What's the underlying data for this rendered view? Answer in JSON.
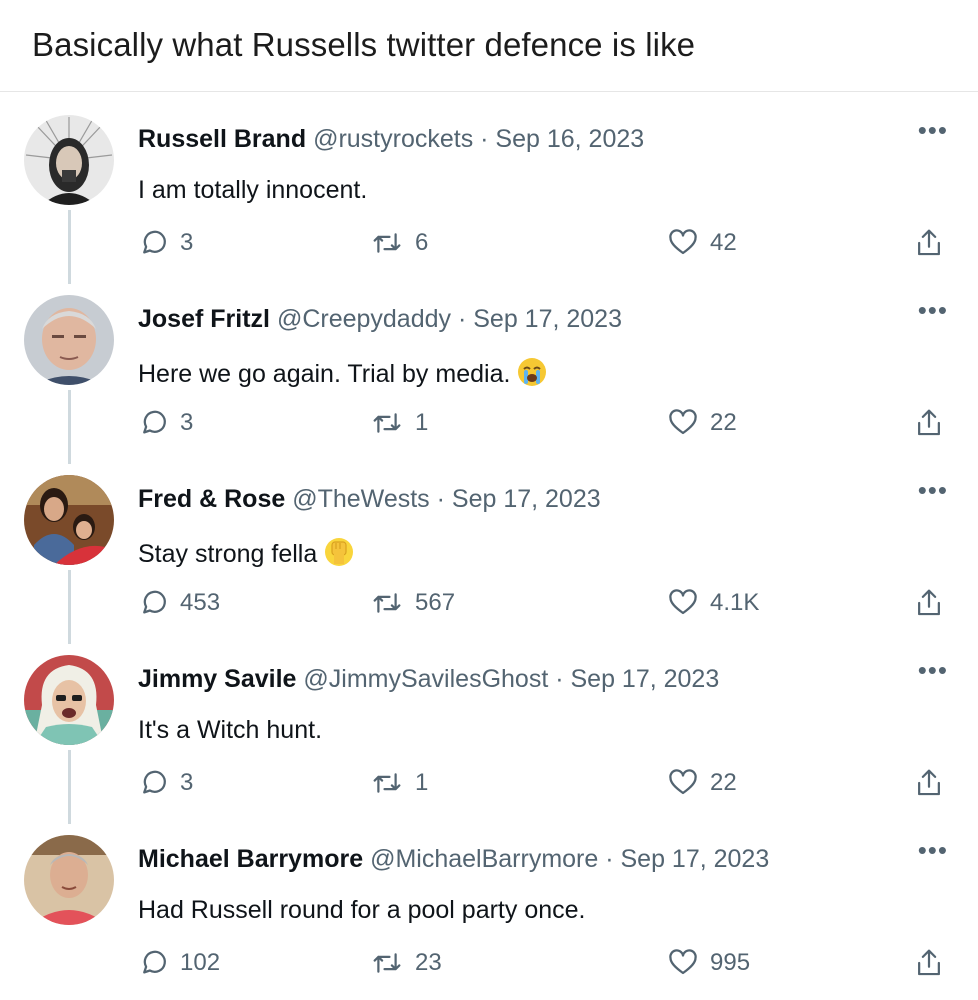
{
  "post": {
    "title": "Basically what Russells twitter defence is like"
  },
  "tweets": [
    {
      "name": "Russell Brand",
      "handle": "@rustyrockets",
      "sep": " · ",
      "date": "Sep 16, 2023",
      "text": "I am totally innocent.",
      "emoji": "",
      "replies": "3",
      "retweets": "6",
      "likes": "42"
    },
    {
      "name": "Josef Fritzl",
      "handle": "@Creepydaddy",
      "sep": " · ",
      "date": "Sep 17, 2023",
      "text": "Here we go again. Trial by media.",
      "emoji": "crying-face",
      "replies": "3",
      "retweets": "1",
      "likes": "22"
    },
    {
      "name": "Fred & Rose",
      "handle": "@TheWests",
      "sep": " · ",
      "date": "Sep 17, 2023",
      "text": "Stay strong fella",
      "emoji": "raised-fist",
      "replies": "453",
      "retweets": "567",
      "likes": "4.1K"
    },
    {
      "name": "Jimmy Savile",
      "handle": "@JimmySavilesGhost",
      "sep": " · ",
      "date": "Sep 17, 2023",
      "text": "It's a Witch hunt.",
      "emoji": "",
      "replies": "3",
      "retweets": "1",
      "likes": "22"
    },
    {
      "name": "Michael Barrymore",
      "handle": "@MichaelBarrymore",
      "sep": " · ",
      "date": "Sep 17, 2023",
      "text": "Had Russell round for a pool party once.",
      "emoji": "",
      "replies": "102",
      "retweets": "23",
      "likes": "995"
    }
  ],
  "icons": {
    "more": "more-icon",
    "reply": "reply-icon",
    "retweet": "retweet-icon",
    "like": "heart-icon",
    "share": "share-icon"
  },
  "colors": {
    "text": "#0f1419",
    "secondary": "#536471",
    "thread_line": "#cfd9de"
  }
}
